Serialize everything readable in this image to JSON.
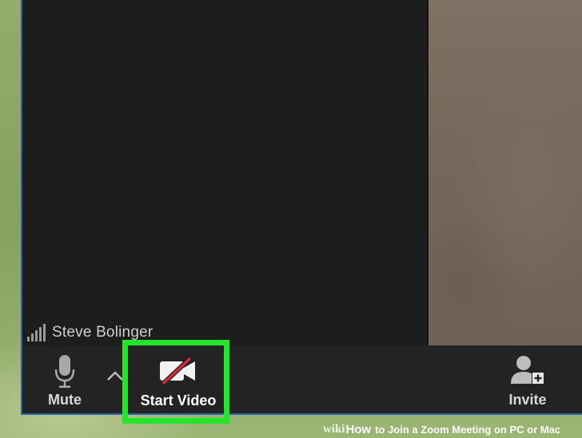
{
  "participant": {
    "name": "Steve Bolinger",
    "signal_icon": "signal-strength-icon"
  },
  "toolbar": {
    "mute": {
      "label": "Mute",
      "icon": "microphone-icon"
    },
    "mute_options_icon": "chevron-up-icon",
    "start_video": {
      "label": "Start Video",
      "icon": "video-off-icon"
    },
    "invite": {
      "label": "Invite",
      "icon": "add-participant-icon"
    }
  },
  "highlight": {
    "color": "#20e028",
    "target": "start_video"
  },
  "footer": {
    "wiki": "wiki",
    "how": "How",
    "title": "to Join a Zoom Meeting on PC or Mac"
  },
  "colors": {
    "window_background": "#1c1c1c",
    "toolbar_background": "#232323",
    "window_border": "#2d5fae",
    "video_off_slash": "#e0283a"
  }
}
